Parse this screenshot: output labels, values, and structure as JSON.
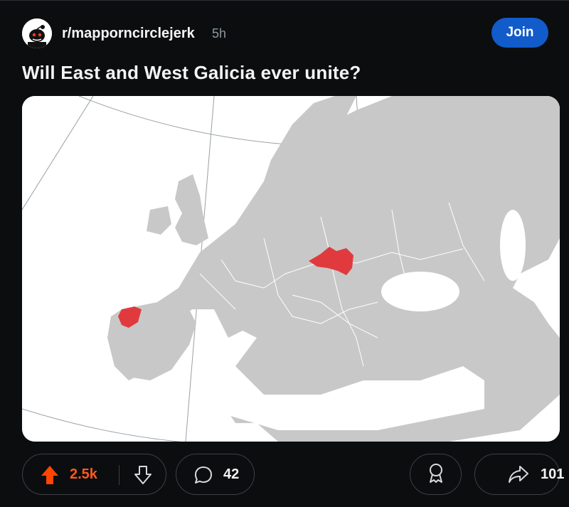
{
  "post": {
    "subreddit": "r/mapporncirclejerk",
    "age": "5h",
    "join_label": "Join",
    "title": "Will East and West Galicia ever unite?"
  },
  "map": {
    "land_color": "#c8c8c8",
    "sea_color": "#ffffff",
    "highlight_color": "#e03a3e",
    "highlighted_regions": [
      "Galicia (Spain)",
      "Galicia (Poland/Ukraine)"
    ]
  },
  "actions": {
    "upvotes": "2.5k",
    "comments": "42",
    "shares": "101",
    "upvote_color": "#ff4500"
  }
}
